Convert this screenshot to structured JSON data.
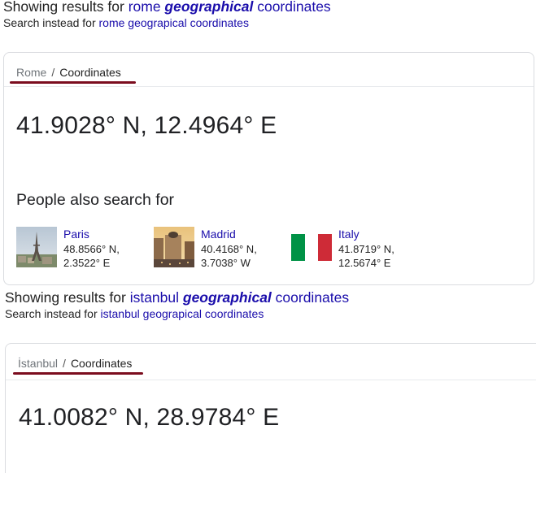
{
  "rome": {
    "showing_prefix": "Showing results for ",
    "query_start": "rome ",
    "query_bold": "geographical",
    "query_end": " coordinates",
    "instead_prefix": "Search instead for ",
    "instead_link": "rome geograpical coordinates",
    "breadcrumb": {
      "entity": "Rome",
      "separator": "/",
      "topic": "Coordinates"
    },
    "coordinates": "41.9028° N, 12.4964° E",
    "people_also_search_title": "People also search for",
    "related": [
      {
        "name": "Paris",
        "lat": "48.8566° N,",
        "lon": "2.3522° E",
        "image": "paris-photo"
      },
      {
        "name": "Madrid",
        "lat": "40.4168° N,",
        "lon": "3.7038° W",
        "image": "madrid-photo"
      },
      {
        "name": "Italy",
        "lat": "41.8719° N,",
        "lon": "12.5674° E",
        "image": "italy-flag"
      }
    ]
  },
  "istanbul": {
    "showing_prefix": "Showing results for ",
    "query_start": "istanbul ",
    "query_bold": "geographical",
    "query_end": " coordinates",
    "instead_prefix": "Search instead for ",
    "instead_link": "istanbul geograpical coordinates",
    "breadcrumb": {
      "entity": "İstanbul",
      "separator": "/",
      "topic": "Coordinates"
    },
    "coordinates": "41.0082° N, 28.9784° E"
  },
  "colors": {
    "link": "#1a0dab",
    "underline_accent": "#7b0c1e",
    "flag_green": "#009246",
    "flag_white": "#ffffff",
    "flag_red": "#ce2b37"
  }
}
